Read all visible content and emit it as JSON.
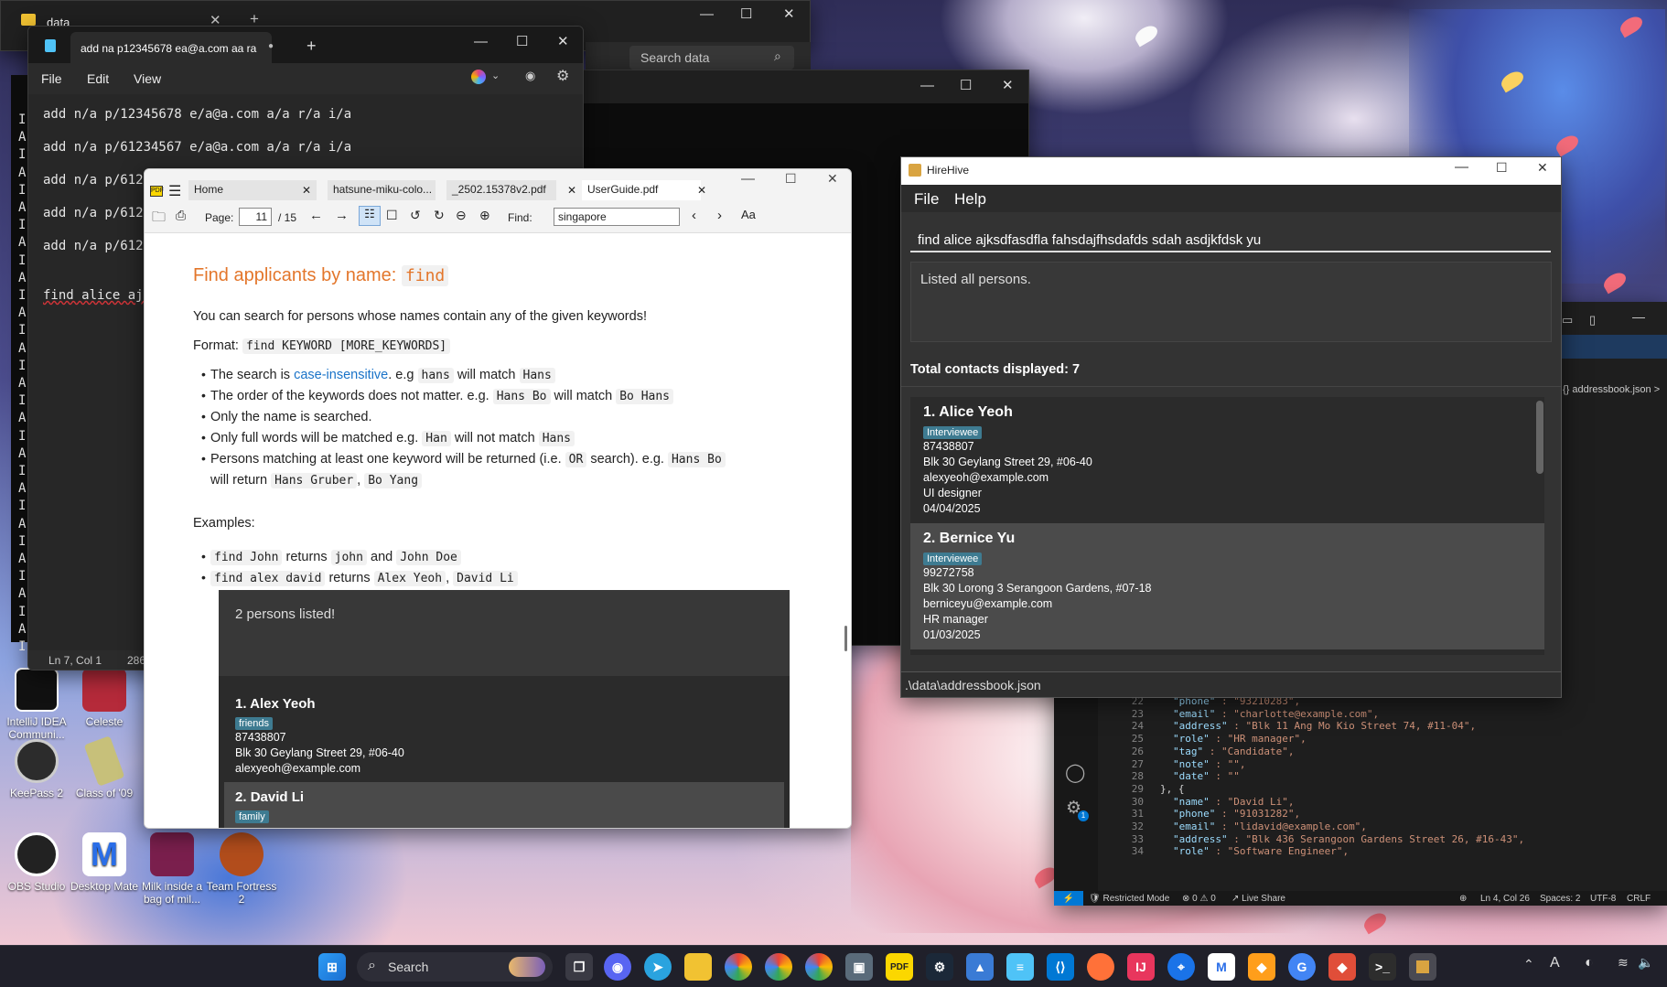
{
  "desktop": {
    "icons": [
      {
        "label": "IntelliJ IDEA Communi..."
      },
      {
        "label": "Celeste"
      },
      {
        "label": "KeePass 2"
      },
      {
        "label": "Class of '09"
      },
      {
        "label": "OBS Studio"
      },
      {
        "label": "Desktop Mate"
      },
      {
        "label": "Milk inside a bag of mil..."
      },
      {
        "label": "Team Fortress 2"
      }
    ]
  },
  "explorer": {
    "tab_title": "data",
    "search_placeholder": "Search data"
  },
  "notepad": {
    "tab_title": "add na p12345678 ea@a.com aa ra",
    "menu": [
      "File",
      "Edit",
      "View"
    ],
    "lines": [
      "add n/a p/12345678 e/a@a.com a/a r/a i/a",
      "add n/a p/61234567 e/a@a.com a/a r/a i/a",
      "add n/a p/6123",
      "add n/a p/6123",
      "add n/a p/6123",
      "find alice ajk"
    ],
    "status_position": "Ln 7, Col 1",
    "status_chars": "286",
    "left_edge_chars": [
      "I",
      "A",
      "I",
      "A",
      "I",
      "A",
      "I",
      "A",
      "I",
      "A",
      "I",
      "A",
      "I",
      "A",
      "I",
      "A",
      "I",
      "A",
      "I",
      "A",
      "I",
      "A",
      "I",
      "A",
      "I",
      "A",
      "I",
      "A",
      "I",
      "A",
      "I"
    ]
  },
  "pdf": {
    "tabs": [
      "Home",
      "hatsune-miku-colo...",
      "_2502.15378v2.pdf",
      "UserGuide.pdf"
    ],
    "page_label": "Page:",
    "page_current": "11",
    "page_total": "/ 15",
    "find_label": "Find:",
    "find_value": "singapore",
    "heading": "Find applicants by name:",
    "heading_code": "find",
    "intro": "You can search for persons whose names contain any of the given keywords!",
    "format_label": "Format:",
    "format_code": "find KEYWORD [MORE_KEYWORDS]",
    "bullets": {
      "b1_pre": "The search is",
      "b1_link": "case-insensitive",
      "b1_mid": ". e.g",
      "b1_code1": "hans",
      "b1_mid2": "will match",
      "b1_code2": "Hans",
      "b2_pre": "The order of the keywords does not matter. e.g.",
      "b2_code1": "Hans Bo",
      "b2_mid": "will match",
      "b2_code2": "Bo Hans",
      "b3": "Only the name is searched.",
      "b4_pre": "Only full words will be matched e.g.",
      "b4_code1": "Han",
      "b4_mid": "will not match",
      "b4_code2": "Hans",
      "b5_pre": "Persons matching at least one keyword will be returned (i.e.",
      "b5_code1": "OR",
      "b5_mid": "search). e.g.",
      "b5_code2": "Hans Bo",
      "b5_line2_pre": "will return",
      "b5_code3": "Hans Gruber",
      "b5_comma": ",",
      "b5_code4": "Bo Yang"
    },
    "examples_label": "Examples:",
    "ex1_code1": "find John",
    "ex1_mid": "returns",
    "ex1_code2": "john",
    "ex1_and": "and",
    "ex1_code3": "John Doe",
    "ex2_code1": "find alex david",
    "ex2_mid": "returns",
    "ex2_code2": "Alex Yeoh",
    "ex2_comma": ",",
    "ex2_code3": "David Li",
    "shot": {
      "result": "2 persons listed!",
      "cards": [
        {
          "index": "1.",
          "name": "Alex Yeoh",
          "tag": "friends",
          "phone": "87438807",
          "address": "Blk 30 Geylang Street 29, #06-40",
          "email": "alexyeoh@example.com"
        },
        {
          "index": "2.",
          "name": "David Li",
          "tag": "family"
        }
      ]
    }
  },
  "hirehive": {
    "title": "HireHive",
    "menu": [
      "File",
      "Help"
    ],
    "command": "find alice ajksdfasdfla fahsdajfhsdafds sdah asdjkfdsk yu",
    "result": "Listed all persons.",
    "total": "Total contacts displayed: 7",
    "cards": [
      {
        "index": "1.",
        "name": "Alice Yeoh",
        "tag": "Interviewee",
        "phone": "87438807",
        "address": "Blk 30 Geylang Street 29, #06-40",
        "email": "alexyeoh@example.com",
        "role": "UI designer",
        "date": "04/04/2025"
      },
      {
        "index": "2.",
        "name": "Bernice Yu",
        "tag": "Interviewee",
        "phone": "99272758",
        "address": "Blk 30 Lorong 3 Serangoon Gardens, #07-18",
        "email": "berniceyu@example.com",
        "role": "HR manager",
        "date": "01/03/2025"
      }
    ],
    "footer": ".\\data\\addressbook.json"
  },
  "vscode": {
    "breadcrumb": "addressbook.json",
    "lines": [
      {
        "n": "22",
        "k": "\"phone\"",
        "v": "\"93210283\","
      },
      {
        "n": "23",
        "k": "\"email\"",
        "v": "\"charlotte@example.com\","
      },
      {
        "n": "24",
        "k": "\"address\"",
        "v": "\"Blk 11 Ang Mo Kio Street 74, #11-04\","
      },
      {
        "n": "25",
        "k": "\"role\"",
        "v": "\"HR manager\","
      },
      {
        "n": "26",
        "k": "\"tag\"",
        "v": "\"Candidate\","
      },
      {
        "n": "27",
        "k": "\"note\"",
        "v": "\"\","
      },
      {
        "n": "28",
        "k": "\"date\"",
        "v": "\"\""
      },
      {
        "n": "29",
        "k": "",
        "v": "}, {"
      },
      {
        "n": "30",
        "k": "\"name\"",
        "v": "\"David Li\","
      },
      {
        "n": "31",
        "k": "\"phone\"",
        "v": "\"91031282\","
      },
      {
        "n": "32",
        "k": "\"email\"",
        "v": "\"lidavid@example.com\","
      },
      {
        "n": "33",
        "k": "\"address\"",
        "v": "\"Blk 436 Serangoon Gardens Street 26, #16-43\","
      },
      {
        "n": "34",
        "k": "\"role\"",
        "v": "\"Software Engineer\","
      }
    ],
    "status": {
      "restricted": "Restricted Mode",
      "problems": "0 ⚠ 0",
      "liveshare": "Live Share",
      "position": "Ln 4, Col 26",
      "spaces": "Spaces: 2",
      "encoding": "UTF-8",
      "eol": "CRLF",
      "settings_badge": "1"
    }
  },
  "taskbar": {
    "search_label": "Search"
  }
}
